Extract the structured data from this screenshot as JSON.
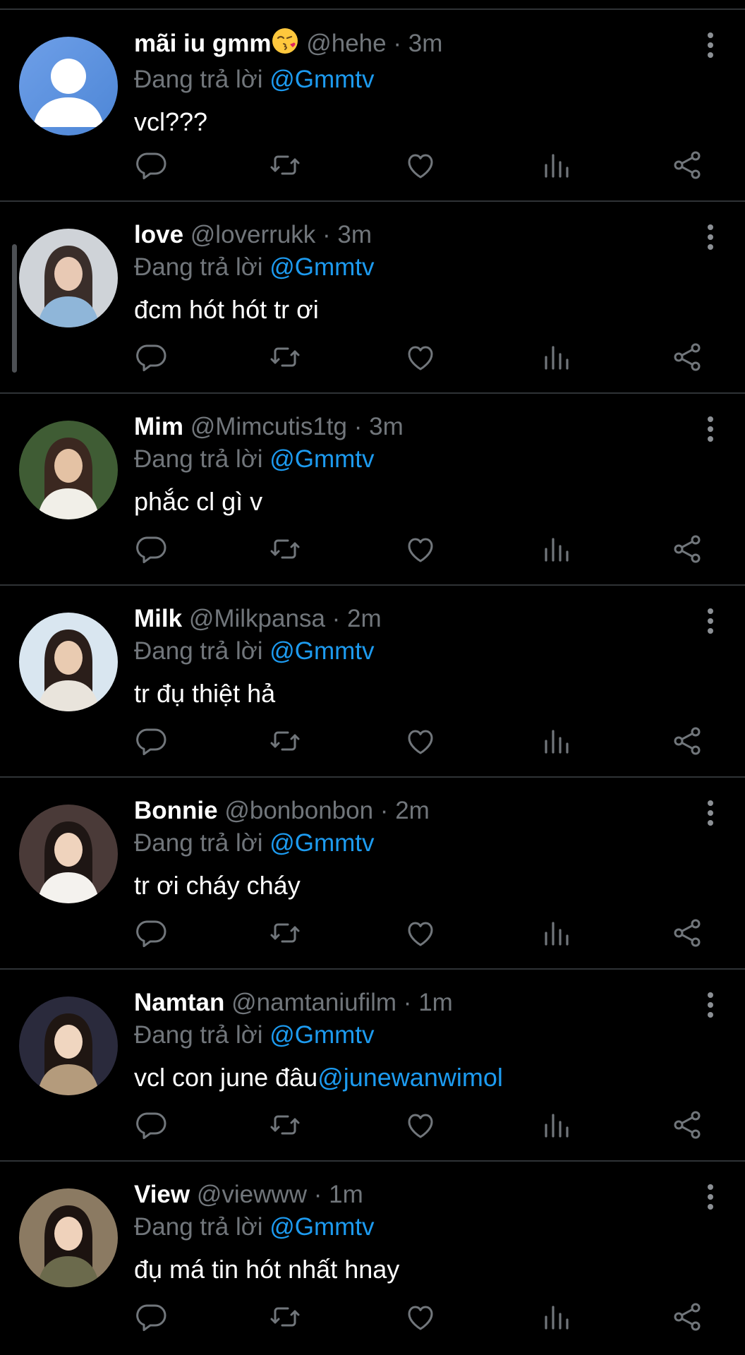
{
  "reply_prefix": "Đang trả lời",
  "separator": "·",
  "colors": {
    "background": "#000000",
    "name": "#ffffff",
    "secondary": "#71767b",
    "mention": "#1d9bf0",
    "divider": "#2f3336"
  },
  "replies": [
    {
      "name": "mãi iu gmm",
      "name_emoji": "face-blowing-kiss-icon",
      "handle": "@hehe",
      "time": "3m",
      "reply_to": "@Gmmtv",
      "text": "vcl???",
      "text_mention": "",
      "avatar": "default-avatar-icon"
    },
    {
      "name": "love",
      "handle": "@loverrukk",
      "time": "3m",
      "reply_to": "@Gmmtv",
      "text": "đcm hót hót tr ơi",
      "text_mention": "",
      "avatar": "photo-avatar"
    },
    {
      "name": "Mim",
      "handle": "@Mimcutis1tg",
      "time": "3m",
      "reply_to": "@Gmmtv",
      "text": "phắc cl gì v",
      "text_mention": "",
      "avatar": "photo-avatar"
    },
    {
      "name": "Milk",
      "handle": "@Milkpansa",
      "time": "2m",
      "reply_to": "@Gmmtv",
      "text": "tr đụ thiệt hả",
      "text_mention": "",
      "avatar": "photo-avatar"
    },
    {
      "name": "Bonnie",
      "handle": "@bonbonbon",
      "time": "2m",
      "reply_to": "@Gmmtv",
      "text": "tr ơi cháy cháy",
      "text_mention": "",
      "avatar": "photo-avatar"
    },
    {
      "name": "Namtan",
      "handle": "@namtaniufilm",
      "time": "1m",
      "reply_to": "@Gmmtv",
      "text": "vcl con june đâu",
      "text_mention": "@junewanwimol",
      "avatar": "photo-avatar"
    },
    {
      "name": "View",
      "handle": "@viewww",
      "time": "1m",
      "reply_to": "@Gmmtv",
      "text": "đụ má tin hót nhất hnay",
      "text_mention": "",
      "avatar": "photo-avatar"
    }
  ],
  "actions": [
    "reply-icon",
    "retweet-icon",
    "like-icon",
    "views-icon",
    "share-icon"
  ]
}
